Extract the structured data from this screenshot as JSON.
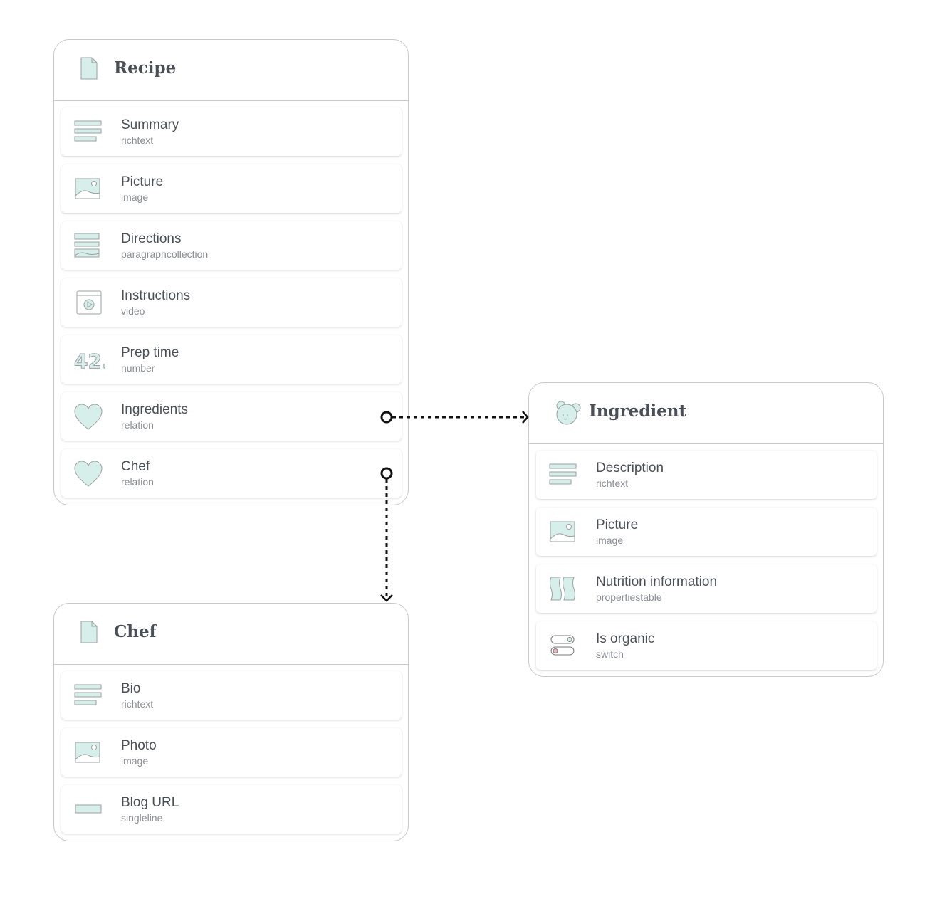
{
  "colors": {
    "icon_fill": "#d6efeb",
    "icon_stroke": "#9aa0a0",
    "connector": "#111111"
  },
  "models": [
    {
      "title": "Recipe",
      "icon": "document-icon",
      "fields": [
        {
          "name": "Summary",
          "type": "richtext",
          "icon": "richtext-icon"
        },
        {
          "name": "Picture",
          "type": "image",
          "icon": "image-icon"
        },
        {
          "name": "Directions",
          "type": "paragraphcollection",
          "icon": "paragraph-collection-icon"
        },
        {
          "name": "Instructions",
          "type": "video",
          "icon": "video-icon"
        },
        {
          "name": "Prep time",
          "type": "number",
          "icon": "number-icon"
        },
        {
          "name": "Ingredients",
          "type": "relation",
          "icon": "heart-icon"
        },
        {
          "name": "Chef",
          "type": "relation",
          "icon": "heart-icon"
        }
      ]
    },
    {
      "title": "Ingredient",
      "icon": "bear-icon",
      "fields": [
        {
          "name": "Description",
          "type": "richtext",
          "icon": "richtext-icon"
        },
        {
          "name": "Picture",
          "type": "image",
          "icon": "image-icon"
        },
        {
          "name": "Nutrition information",
          "type": "propertiestable",
          "icon": "properties-table-icon"
        },
        {
          "name": "Is organic",
          "type": "switch",
          "icon": "switch-icon"
        }
      ]
    },
    {
      "title": "Chef",
      "icon": "document-icon",
      "fields": [
        {
          "name": "Bio",
          "type": "richtext",
          "icon": "richtext-icon"
        },
        {
          "name": "Photo",
          "type": "image",
          "icon": "image-icon"
        },
        {
          "name": "Blog URL",
          "type": "singleline",
          "icon": "singleline-icon"
        }
      ]
    }
  ],
  "relations": [
    {
      "from": "Recipe.Ingredients",
      "to": "Ingredient"
    },
    {
      "from": "Recipe.Chef",
      "to": "Chef"
    }
  ]
}
